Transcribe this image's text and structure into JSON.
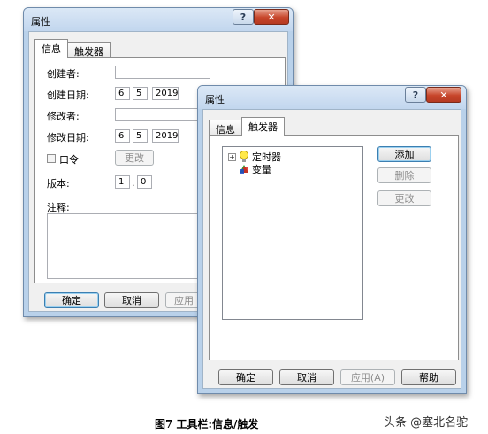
{
  "back_window": {
    "title": "属性",
    "tabs": [
      "信息",
      "触发器"
    ],
    "fields": {
      "creator_label": "创建者:",
      "created_date_label": "创建日期:",
      "created_day": "6",
      "created_month": "5",
      "created_year": "2019",
      "modifier_label": "修改者:",
      "modified_date_label": "修改日期:",
      "modified_day": "6",
      "modified_month": "5",
      "modified_year": "2019",
      "password_label": "口令",
      "change_button": "更改",
      "version_label": "版本:",
      "version_major": "1",
      "version_minor": "0",
      "notes_label": "注释:"
    },
    "buttons": {
      "ok": "确定",
      "cancel": "取消",
      "apply": "应用"
    }
  },
  "front_window": {
    "title": "属性",
    "tabs": [
      "信息",
      "触发器"
    ],
    "tree_items": [
      "定时器",
      "变量"
    ],
    "side_buttons": {
      "add": "添加",
      "delete": "删除",
      "change": "更改"
    },
    "buttons": {
      "ok": "确定",
      "cancel": "取消",
      "apply": "应用(A)",
      "help": "帮助"
    }
  },
  "caption": "图7 工具栏:信息/触发",
  "watermark": "头条 @塞北名驼"
}
